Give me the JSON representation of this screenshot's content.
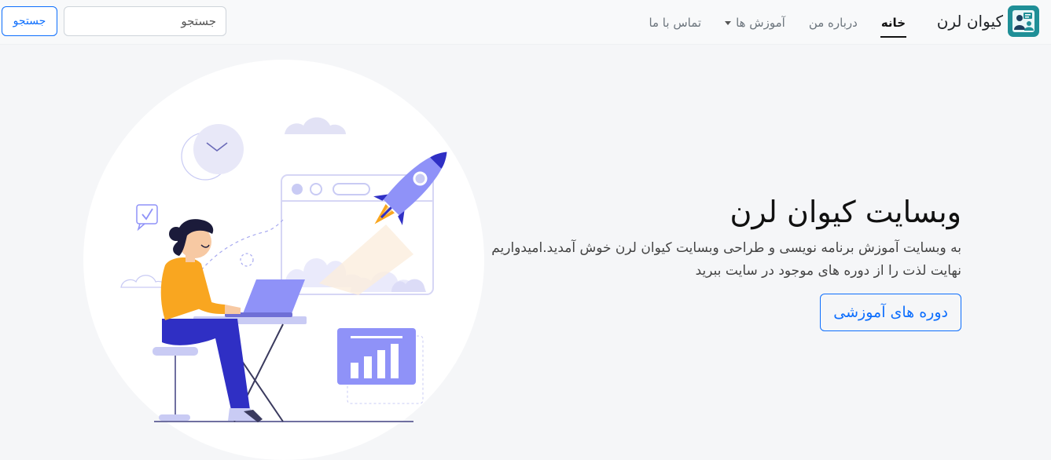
{
  "navbar": {
    "brand_name": "کیوان لرن",
    "links": [
      {
        "label": "خانه",
        "active": true
      },
      {
        "label": "درباره من",
        "active": false
      },
      {
        "label": "آموزش ها",
        "active": false,
        "dropdown": true
      },
      {
        "label": "تماس با ما",
        "active": false
      }
    ],
    "search": {
      "placeholder": "جستجو",
      "button_label": "جستجو"
    }
  },
  "hero": {
    "title": "وبسایت کیوان لرن",
    "description": "به وبسایت آموزش برنامه نویسی و طراحی وبسایت کیوان لرن خوش آمدید.امیدواریم نهایت لذت را از دوره های موجود در سایت ببرید",
    "cta_label": "دوره های آموزشی"
  },
  "colors": {
    "primary": "#0d6efd",
    "navbar_bg": "#f8f9fa",
    "page_bg": "#f5f6f8",
    "illustration_accent": "#8f92f8",
    "illustration_dark": "#2f2fc4",
    "illustration_orange": "#f9a620"
  },
  "icons": {
    "brand_logo": "instructor-logo-icon",
    "dropdown": "caret-down-icon"
  }
}
